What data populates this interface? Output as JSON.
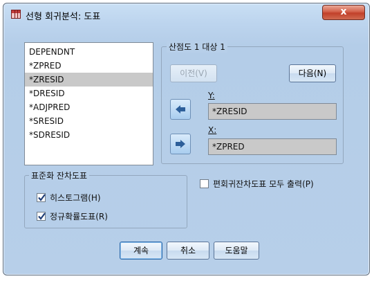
{
  "window": {
    "title": "선형 회귀분석: 도표",
    "close_glyph": "x"
  },
  "variables": [
    {
      "label": "DEPENDNT",
      "selected": false
    },
    {
      "label": "*ZPRED",
      "selected": false
    },
    {
      "label": "*ZRESID",
      "selected": true
    },
    {
      "label": "*DRESID",
      "selected": false
    },
    {
      "label": "*ADJPRED",
      "selected": false
    },
    {
      "label": "*SRESID",
      "selected": false
    },
    {
      "label": "*SDRESID",
      "selected": false
    }
  ],
  "scatter_group": {
    "label": "산점도 1 대상 1",
    "previous_label": "이전(V)",
    "next_label": "다음(N)",
    "y_label": "Y:",
    "y_value": "*ZRESID",
    "x_label": "X:",
    "x_value": "*ZPRED"
  },
  "partial_plots": {
    "label": "편회귀잔차도표 모두 출력(P)",
    "checked": false
  },
  "std_resid_group": {
    "label": "표준화 잔차도표",
    "histogram_label": "히스토그램(H)",
    "histogram_checked": true,
    "normal_prob_label": "정규확률도표(R)",
    "normal_prob_checked": true
  },
  "buttons": {
    "continue": "계속",
    "cancel": "취소",
    "help": "도움말"
  },
  "icons": {
    "move_y": "arrow-left-icon",
    "move_x": "arrow-right-icon"
  }
}
